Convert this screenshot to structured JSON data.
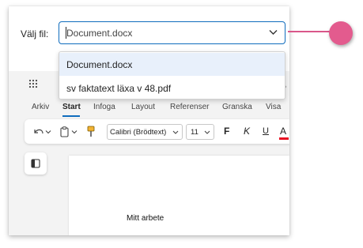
{
  "file_picker": {
    "label": "Välj fil:",
    "selected": "Document.docx",
    "options": [
      "Document.docx",
      "sv faktatext läxa v 48.pdf"
    ]
  },
  "ribbon": {
    "tabs": [
      "Arkiv",
      "Start",
      "Infoga",
      "Layout",
      "Referenser",
      "Granska",
      "Visa"
    ],
    "active_tab": "Start",
    "font_name": "Calibri (Brödtext)",
    "font_size": "11",
    "bold_label": "F",
    "italic_label": "K",
    "underline_label": "U",
    "font_color_label": "A",
    "clipped_fragment": "›"
  },
  "document": {
    "text": "Mitt arbete"
  },
  "colors": {
    "accent": "#0f6cbd",
    "marker": "#e35b8e",
    "connector": "#d9578a",
    "font_color_bar": "#e81123"
  },
  "icons": [
    "chevron-down-icon",
    "app-launcher-icon",
    "undo-icon",
    "clipboard-icon",
    "format-painter-icon",
    "navigation-pane-icon"
  ]
}
